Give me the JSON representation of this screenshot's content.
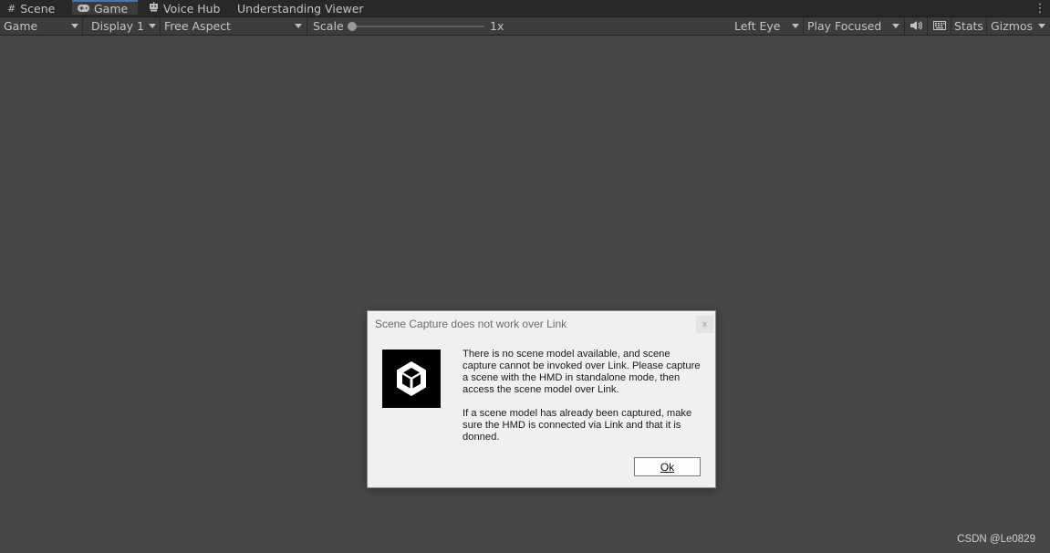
{
  "tabs": [
    {
      "label": "Scene",
      "icon": "grid-icon"
    },
    {
      "label": "Game",
      "icon": "gamepad-icon",
      "active": true
    },
    {
      "label": "Voice Hub",
      "icon": "robot-icon"
    },
    {
      "label": "Understanding Viewer",
      "icon": ""
    }
  ],
  "toolbar": {
    "view_mode": "Game",
    "display": "Display 1",
    "aspect": "Free Aspect",
    "scale_label": "Scale",
    "scale_value": "1x",
    "eye": "Left Eye",
    "play_mode": "Play Focused",
    "stats": "Stats",
    "gizmos": "Gizmos"
  },
  "dialog": {
    "title": "Scene Capture does not work over Link",
    "close": "x",
    "message_1": "There is no scene model available, and scene capture cannot be invoked over Link. Please capture a scene with the HMD in standalone mode, then access the scene model over Link.",
    "message_2": "If a scene model has already been captured, make sure the HMD is connected via Link and that it is donned.",
    "ok_label": "Ok"
  },
  "watermark": "CSDN @Le0829",
  "colors": {
    "background": "#474747",
    "active_tab_accent": "#3a79bb",
    "dialog_bg": "#f0f0f0"
  }
}
